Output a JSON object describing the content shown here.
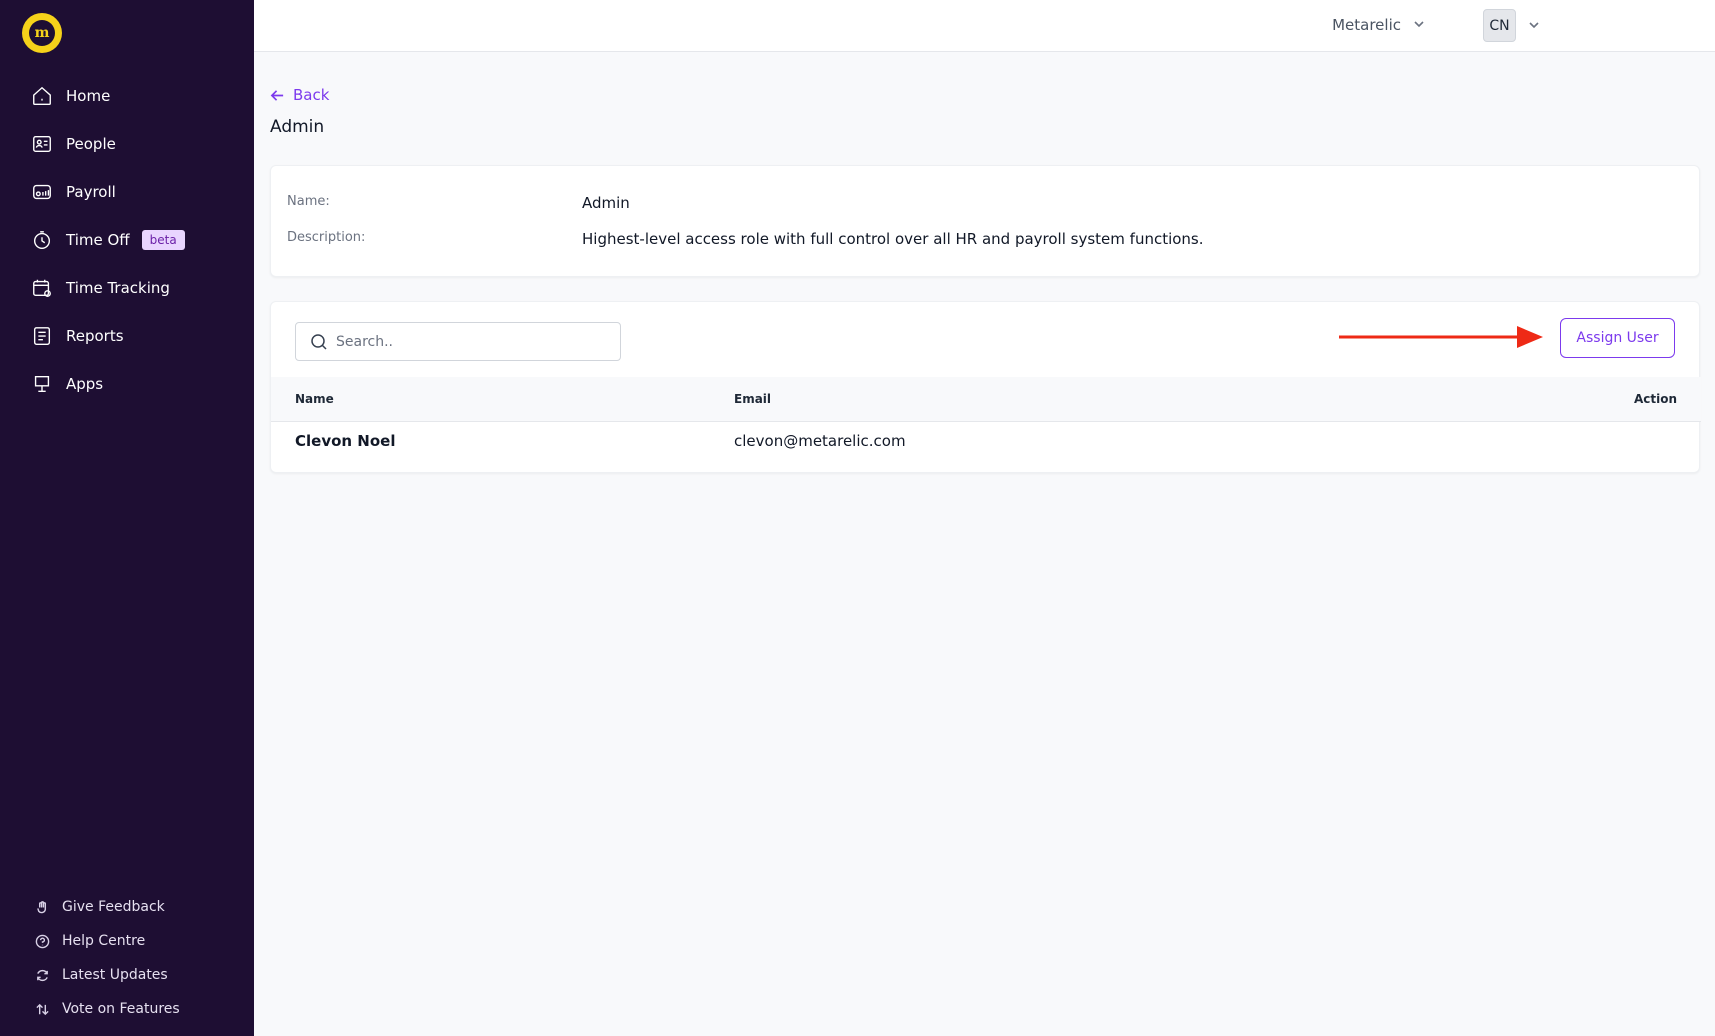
{
  "sidebar": {
    "logo_text": "m",
    "items": [
      {
        "label": "Home",
        "icon": "home-icon"
      },
      {
        "label": "People",
        "icon": "people-icon"
      },
      {
        "label": "Payroll",
        "icon": "payroll-icon"
      },
      {
        "label": "Time Off",
        "icon": "timer-icon",
        "badge": "beta"
      },
      {
        "label": "Time Tracking",
        "icon": "calendar-check-icon"
      },
      {
        "label": "Reports",
        "icon": "reports-icon"
      },
      {
        "label": "Apps",
        "icon": "apps-icon"
      }
    ],
    "footer": [
      {
        "label": "Give Feedback",
        "icon": "hand-icon"
      },
      {
        "label": "Help Centre",
        "icon": "help-icon"
      },
      {
        "label": "Latest Updates",
        "icon": "refresh-icon"
      },
      {
        "label": "Vote on Features",
        "icon": "sort-arrows-icon"
      }
    ]
  },
  "topbar": {
    "org_name": "Metarelic",
    "avatar_initials": "CN"
  },
  "main": {
    "back_label": "Back",
    "title": "Admin",
    "details": {
      "name_label": "Name:",
      "name_value": "Admin",
      "description_label": "Description:",
      "description_value": "Highest-level access role with full control over all HR and payroll system functions."
    },
    "users": {
      "search_placeholder": "Search..",
      "assign_label": "Assign User",
      "columns": [
        "Name",
        "Email",
        "Action"
      ],
      "rows": [
        {
          "name": "Clevon Noel",
          "email": "clevon@metarelic.com"
        }
      ]
    }
  },
  "colors": {
    "sidebar_bg": "#1e0e33",
    "accent": "#7c3aed",
    "logo": "#f6d21a",
    "annotation_arrow": "#ee2a16"
  }
}
